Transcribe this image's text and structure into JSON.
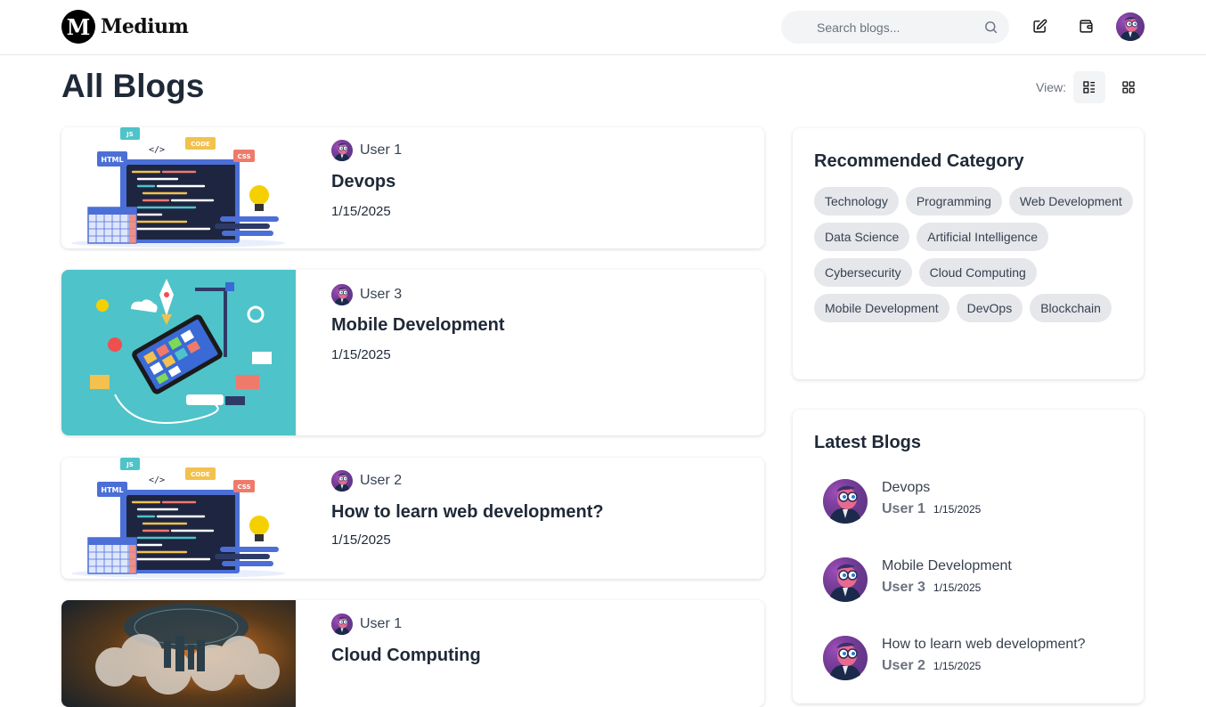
{
  "header": {
    "brand_logo_letter": "M",
    "brand_name": "Medium",
    "search_placeholder": "Search blogs...",
    "icons": [
      "search-icon",
      "edit-icon",
      "wallet-icon",
      "avatar"
    ]
  },
  "page": {
    "title": "All Blogs",
    "view_label": "View:",
    "view_modes": [
      "list-view-icon",
      "grid-view-icon"
    ],
    "active_view": "list"
  },
  "blogs": [
    {
      "author": "User 1",
      "title": "Devops",
      "date": "1/15/2025",
      "image": "web-dev-illustration"
    },
    {
      "author": "User 3",
      "title": "Mobile Development",
      "date": "1/15/2025",
      "image": "mobile-dev-illustration"
    },
    {
      "author": "User 2",
      "title": "How to learn web development?",
      "date": "1/15/2025",
      "image": "web-dev-illustration"
    },
    {
      "author": "User 1",
      "title": "Cloud Computing",
      "date": "",
      "image": "cloud-illustration"
    }
  ],
  "sidebar": {
    "recommended_title": "Recommended Category",
    "categories": [
      "Technology",
      "Programming",
      "Web Development",
      "Data Science",
      "Artificial Intelligence",
      "Cybersecurity",
      "Cloud Computing",
      "Mobile Development",
      "DevOps",
      "Blockchain"
    ],
    "latest_title": "Latest Blogs",
    "latest": [
      {
        "title": "Devops",
        "author": "User 1",
        "date": "1/15/2025"
      },
      {
        "title": "Mobile Development",
        "author": "User 3",
        "date": "1/15/2025"
      },
      {
        "title": "How to learn web development?",
        "author": "User 2",
        "date": "1/15/2025"
      }
    ]
  },
  "colors": {
    "accent_teal": "#4ec3c9",
    "chip_bg": "#e5e7eb",
    "text_dark": "#1f2937",
    "text_muted": "#6b7280"
  }
}
